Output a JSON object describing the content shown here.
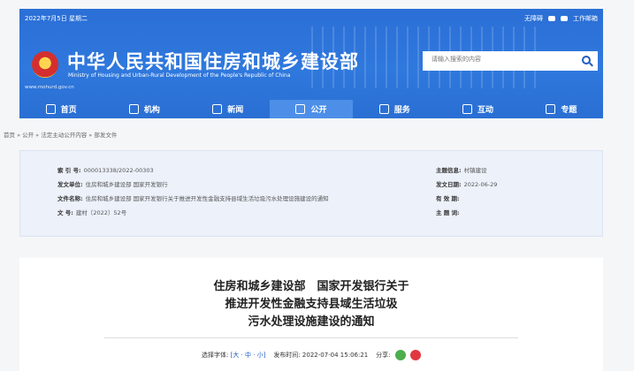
{
  "header": {
    "date": "2022年7月5日 星期二",
    "links": [
      "无障碍",
      "",
      "工作邮箱"
    ],
    "title_cn": "中华人民共和国住房和城乡建设部",
    "title_en": "Ministry of Housing and Urban-Rural Development of the People's Republic of China",
    "url": "www.mohurd.gov.cn",
    "search_placeholder": "请输入搜索的内容"
  },
  "nav": [
    {
      "label": "首页",
      "icon": "home-icon"
    },
    {
      "label": "机构",
      "icon": "building-icon"
    },
    {
      "label": "新闻",
      "icon": "news-icon"
    },
    {
      "label": "公开",
      "icon": "public-icon",
      "active": true
    },
    {
      "label": "服务",
      "icon": "service-icon"
    },
    {
      "label": "互动",
      "icon": "interaction-icon"
    },
    {
      "label": "专题",
      "icon": "topic-icon"
    }
  ],
  "breadcrumb": "首页 » 公开 » 法定主动公开内容 » 部发文件",
  "meta": {
    "index_label": "索 引 号:",
    "index_value": "000013338/2022-00303",
    "issuer_label": "发文单位:",
    "issuer_value": "住房和城乡建设部 国家开发银行",
    "name_label": "文件名称:",
    "name_value": "住房和城乡建设部 国家开发银行关于推进开发性金融支持县域生活垃圾污水处理设施建设的通知",
    "number_label": "文      号:",
    "number_value": "建村〔2022〕52号",
    "topic_label": "主题信息:",
    "topic_value": "村镇建设",
    "date_label": "发文日期:",
    "date_value": "2022-06-29",
    "valid_label": "有 效 期:",
    "valid_value": "",
    "subject_label": "主 题 词:",
    "subject_value": ""
  },
  "doc": {
    "title_lines": [
      "住房和城乡建设部　国家开发银行关于",
      "推进开发性金融支持县域生活垃圾",
      "污水处理设施建设的通知"
    ],
    "font_label": "选择字体:",
    "font_options": "[大 · 中 · 小]",
    "publish_label": "发布时间:",
    "publish_time": "2022-07-04 15:06:21",
    "share_label": "分享:"
  }
}
